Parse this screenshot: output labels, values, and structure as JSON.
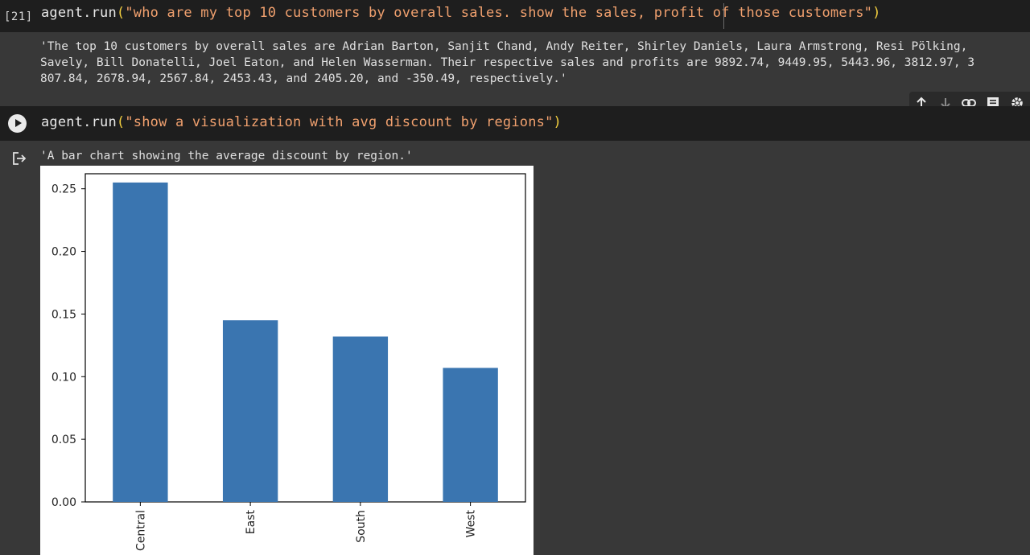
{
  "cell1": {
    "execution_count": "[21]",
    "code": {
      "fn": "agent.run",
      "open": "(",
      "arg": "\"who are my top 10 customers by overall sales. show the sales, profit of those customers\"",
      "close": ")"
    },
    "output_lines": [
      "'The top 10 customers by overall sales are Adrian Barton, Sanjit Chand, Andy Reiter, Shirley Daniels, Laura Armstrong, Resi Pölking, ",
      "Savely, Bill Donatelli, Joel Eaton, and Helen Wasserman. Their respective sales and profits are 9892.74, 9449.95, 5443.96, 3812.97, 3",
      "807.84, 2678.94, 2567.84, 2453.43, and 2405.20, and -350.49, respectively.'"
    ]
  },
  "toolbar": {
    "icons": [
      "arrow-up-icon",
      "arrow-down-icon",
      "link-icon",
      "comment-icon",
      "gear-icon"
    ]
  },
  "cell2": {
    "code": {
      "fn": "agent.run",
      "open": "(",
      "arg": "\"show a visualization with avg discount by regions\"",
      "close": ")"
    },
    "output_text": "'A bar chart showing the average discount by region.'"
  },
  "colors": {
    "bar": "#3a75b0",
    "code_bg": "#1e1e1e",
    "page_bg": "#383838",
    "string": "#f0a06e",
    "paren": "#f4d03f"
  },
  "chart_data": {
    "type": "bar",
    "categories": [
      "Central",
      "East",
      "South",
      "West"
    ],
    "values": [
      0.255,
      0.145,
      0.132,
      0.107
    ],
    "title": "",
    "xlabel": "",
    "ylabel": "",
    "ylim": [
      0,
      0.262
    ],
    "yticks": [
      "0.00",
      "0.05",
      "0.10",
      "0.15",
      "0.20",
      "0.25"
    ],
    "ytick_values": [
      0,
      0.05,
      0.1,
      0.15,
      0.2,
      0.25
    ],
    "grid": false,
    "bar_color": "#3a75b0"
  }
}
